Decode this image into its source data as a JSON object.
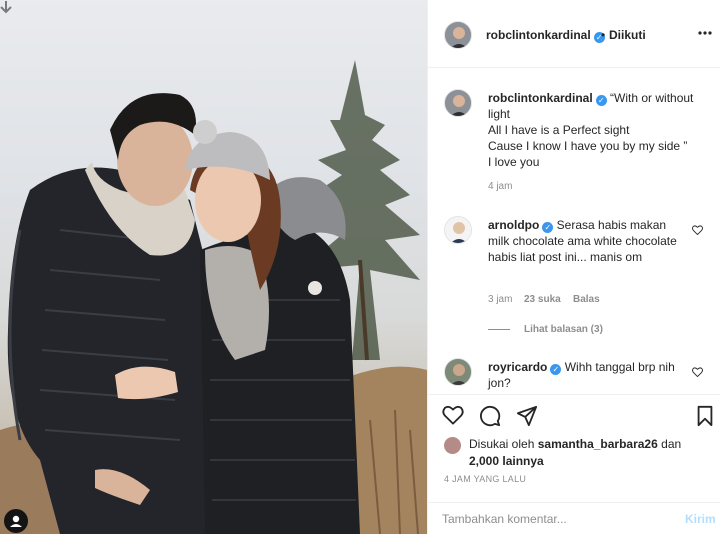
{
  "post": {
    "author": "robclintonkardinal",
    "follow_status": "Diikuti",
    "separator": "•",
    "caption": "“With or without light\nAll I have is a Perfect sight\nCause I know I have you by my side ”\nI love you",
    "caption_time": "4 jam"
  },
  "comments": [
    {
      "username": "arnoldpo",
      "text": "Serasa habis makan milk chocolate ama white chocolate habis liat post ini... manis om",
      "time": "3 jam",
      "likes": "23 suka",
      "reply_label": "Balas",
      "view_replies": "Lihat balasan (3)"
    },
    {
      "username": "royricardo",
      "text": "Wihh tanggal brp nih jon?"
    }
  ],
  "likes": {
    "prefix": "Disukai oleh",
    "user": "samantha_barbara26",
    "conj": "dan",
    "others": "2,000 lainnya"
  },
  "timestamp": "4 JAM YANG LALU",
  "add_comment": {
    "placeholder": "Tambahkan komentar...",
    "post_label": "Kirim"
  },
  "icons": {
    "more": "more-options-icon",
    "like": "heart-icon",
    "comment": "comment-icon",
    "share": "share-icon",
    "save": "bookmark-icon",
    "download": "download-arrow-icon",
    "tag": "user-tag-icon"
  },
  "colors": {
    "verified": "#3897f0",
    "muted": "#8e8e8e",
    "text": "#262626",
    "post_disabled": "#b2dffc"
  }
}
